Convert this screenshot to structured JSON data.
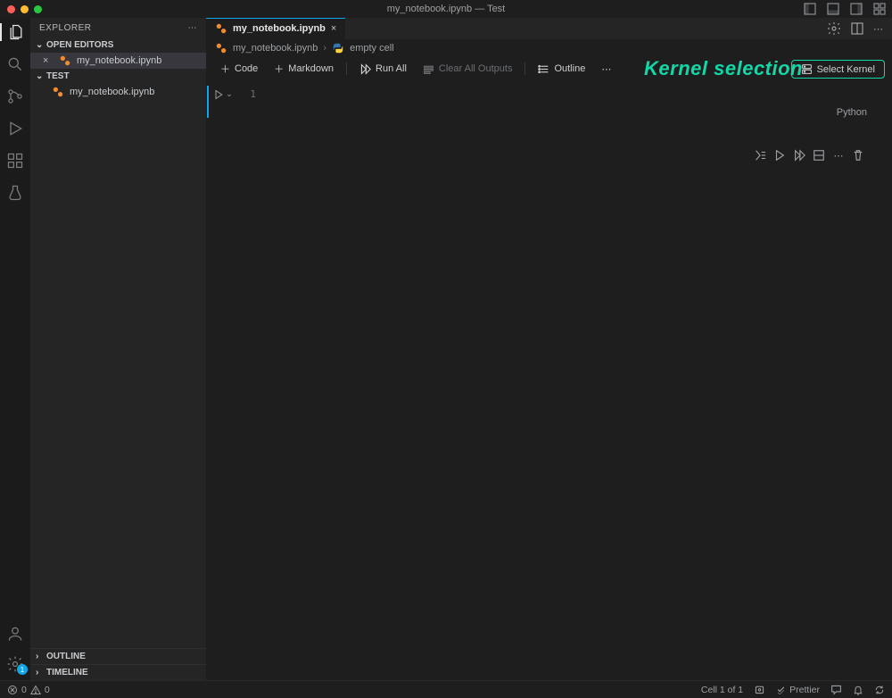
{
  "title": "my_notebook.ipynb — Test",
  "titlebar_icons": [
    "layout-primary-icon",
    "layout-panel-icon",
    "layout-secondary-icon",
    "layout-custom-icon"
  ],
  "activity": {
    "gear_badge": "1"
  },
  "sidebar": {
    "title": "EXPLORER",
    "open_editors_label": "OPEN EDITORS",
    "folder_label": "TEST",
    "open_editor_file": "my_notebook.ipynb",
    "folder_file": "my_notebook.ipynb",
    "outline_label": "OUTLINE",
    "timeline_label": "TIMELINE"
  },
  "tab": {
    "label": "my_notebook.ipynb"
  },
  "breadcrumb": {
    "file": "my_notebook.ipynb",
    "cell": "empty cell"
  },
  "toolbar": {
    "code": "Code",
    "markdown": "Markdown",
    "run_all": "Run All",
    "clear_all": "Clear All Outputs",
    "outline": "Outline",
    "select_kernel": "Select Kernel"
  },
  "annotation": "Kernel selection",
  "cell": {
    "line_number": "1",
    "content": "",
    "language": "Python"
  },
  "status": {
    "errors": "0",
    "warnings": "0",
    "cell_pos": "Cell 1 of 1",
    "prettier": "Prettier"
  }
}
